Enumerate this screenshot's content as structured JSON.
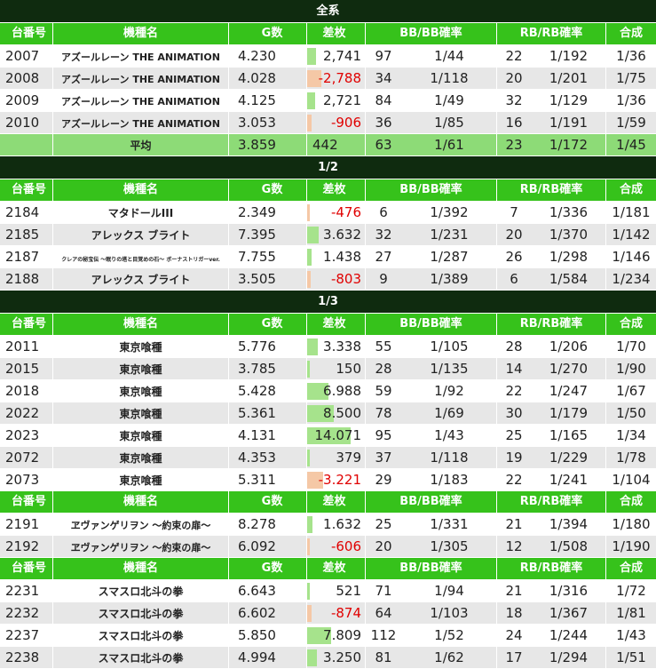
{
  "headers": [
    "台番号",
    "機種名",
    "G数",
    "差枚",
    "BB/BB確率",
    "RB/RB確率",
    "合成"
  ],
  "sections": [
    {
      "title": "全系",
      "groups": [
        {
          "rows": [
            {
              "no": "2007",
              "name": "アズールレーン THE ANIMATION",
              "g": "4.230",
              "diff": "2,741",
              "diff_value": 2741,
              "bb": "97",
              "bbp": "1/44",
              "rb": "22",
              "rbp": "1/192",
              "comb": "1/36"
            },
            {
              "no": "2008",
              "name": "アズールレーン THE ANIMATION",
              "g": "4.028",
              "diff": "-2,788",
              "diff_value": -2788,
              "bb": "34",
              "bbp": "1/118",
              "rb": "20",
              "rbp": "1/201",
              "comb": "1/75"
            },
            {
              "no": "2009",
              "name": "アズールレーン THE ANIMATION",
              "g": "4.125",
              "diff": "2,721",
              "diff_value": 2721,
              "bb": "84",
              "bbp": "1/49",
              "rb": "32",
              "rbp": "1/129",
              "comb": "1/36"
            },
            {
              "no": "2010",
              "name": "アズールレーン THE ANIMATION",
              "g": "3.053",
              "diff": "-906",
              "diff_value": -906,
              "bb": "36",
              "bbp": "1/85",
              "rb": "16",
              "rbp": "1/191",
              "comb": "1/59"
            }
          ],
          "average": {
            "label": "平均",
            "g": "3.859",
            "diff": "442",
            "bb": "63",
            "bbp": "1/61",
            "rb": "23",
            "rbp": "1/172",
            "comb": "1/45"
          }
        }
      ]
    },
    {
      "title": "1/2",
      "groups": [
        {
          "rows": [
            {
              "no": "2184",
              "name": "マタドールIII",
              "g": "2.349",
              "diff": "-476",
              "diff_value": -476,
              "bb": "6",
              "bbp": "1/392",
              "rb": "7",
              "rbp": "1/336",
              "comb": "1/181"
            },
            {
              "no": "2185",
              "name": "アレックス ブライト",
              "g": "7.395",
              "diff": "3.632",
              "diff_value": 3632,
              "bb": "32",
              "bbp": "1/231",
              "rb": "20",
              "rbp": "1/370",
              "comb": "1/142"
            },
            {
              "no": "2187",
              "name": "クレアの秘宝伝 ～眠りの塔と目覚めの石～ ボーナストリガーver.",
              "g": "7.755",
              "diff": "1.438",
              "diff_value": 1438,
              "bb": "27",
              "bbp": "1/287",
              "rb": "26",
              "rbp": "1/298",
              "comb": "1/146",
              "tiny": true
            },
            {
              "no": "2188",
              "name": "アレックス ブライト",
              "g": "3.505",
              "diff": "-803",
              "diff_value": -803,
              "bb": "9",
              "bbp": "1/389",
              "rb": "6",
              "rbp": "1/584",
              "comb": "1/234"
            }
          ]
        }
      ]
    },
    {
      "title": "1/3",
      "groups": [
        {
          "rows": [
            {
              "no": "2011",
              "name": "東京喰種",
              "g": "5.776",
              "diff": "3.338",
              "diff_value": 3338,
              "bb": "55",
              "bbp": "1/105",
              "rb": "28",
              "rbp": "1/206",
              "comb": "1/70"
            },
            {
              "no": "2015",
              "name": "東京喰種",
              "g": "3.785",
              "diff": "150",
              "diff_value": 150,
              "bb": "28",
              "bbp": "1/135",
              "rb": "14",
              "rbp": "1/270",
              "comb": "1/90"
            },
            {
              "no": "2018",
              "name": "東京喰種",
              "g": "5.428",
              "diff": "6.988",
              "diff_value": 6988,
              "bb": "59",
              "bbp": "1/92",
              "rb": "22",
              "rbp": "1/247",
              "comb": "1/67"
            },
            {
              "no": "2022",
              "name": "東京喰種",
              "g": "5.361",
              "diff": "8.500",
              "diff_value": 8500,
              "bb": "78",
              "bbp": "1/69",
              "rb": "30",
              "rbp": "1/179",
              "comb": "1/50"
            },
            {
              "no": "2023",
              "name": "東京喰種",
              "g": "4.131",
              "diff": "14.071",
              "diff_value": 14071,
              "bb": "95",
              "bbp": "1/43",
              "rb": "25",
              "rbp": "1/165",
              "comb": "1/34"
            },
            {
              "no": "2072",
              "name": "東京喰種",
              "g": "4.353",
              "diff": "379",
              "diff_value": 379,
              "bb": "37",
              "bbp": "1/118",
              "rb": "19",
              "rbp": "1/229",
              "comb": "1/78"
            },
            {
              "no": "2073",
              "name": "東京喰種",
              "g": "5.311",
              "diff": "-3.221",
              "diff_value": -3221,
              "bb": "29",
              "bbp": "1/183",
              "rb": "22",
              "rbp": "1/241",
              "comb": "1/104"
            }
          ]
        },
        {
          "rows": [
            {
              "no": "2191",
              "name": "ヱヴァンゲリヲン ～約束の扉～",
              "g": "8.278",
              "diff": "1.632",
              "diff_value": 1632,
              "bb": "25",
              "bbp": "1/331",
              "rb": "21",
              "rbp": "1/394",
              "comb": "1/180"
            },
            {
              "no": "2192",
              "name": "ヱヴァンゲリヲン ～約束の扉～",
              "g": "6.092",
              "diff": "-606",
              "diff_value": -606,
              "bb": "20",
              "bbp": "1/305",
              "rb": "12",
              "rbp": "1/508",
              "comb": "1/190"
            }
          ]
        },
        {
          "rows": [
            {
              "no": "2231",
              "name": "スマスロ北斗の拳",
              "g": "6.643",
              "diff": "521",
              "diff_value": 521,
              "bb": "71",
              "bbp": "1/94",
              "rb": "21",
              "rbp": "1/316",
              "comb": "1/72"
            },
            {
              "no": "2232",
              "name": "スマスロ北斗の拳",
              "g": "6.602",
              "diff": "-874",
              "diff_value": -874,
              "bb": "64",
              "bbp": "1/103",
              "rb": "18",
              "rbp": "1/367",
              "comb": "1/81"
            },
            {
              "no": "2237",
              "name": "スマスロ北斗の拳",
              "g": "5.850",
              "diff": "7.809",
              "diff_value": 7809,
              "bb": "112",
              "bbp": "1/52",
              "rb": "24",
              "rbp": "1/244",
              "comb": "1/43"
            },
            {
              "no": "2238",
              "name": "スマスロ北斗の拳",
              "g": "4.994",
              "diff": "3.250",
              "diff_value": 3250,
              "bb": "81",
              "bbp": "1/62",
              "rb": "17",
              "rbp": "1/294",
              "comb": "1/51"
            }
          ]
        }
      ]
    }
  ],
  "colors": {
    "section_title_bg": "#0f2b0f",
    "header_bg": "#36c21b",
    "avg_bg": "#8ddb77",
    "row_alt_bg": "#e7e7e7",
    "pos_bar": "#a6e38c",
    "neg_bar": "#f5c8a6",
    "neg_text": "#e00000"
  }
}
